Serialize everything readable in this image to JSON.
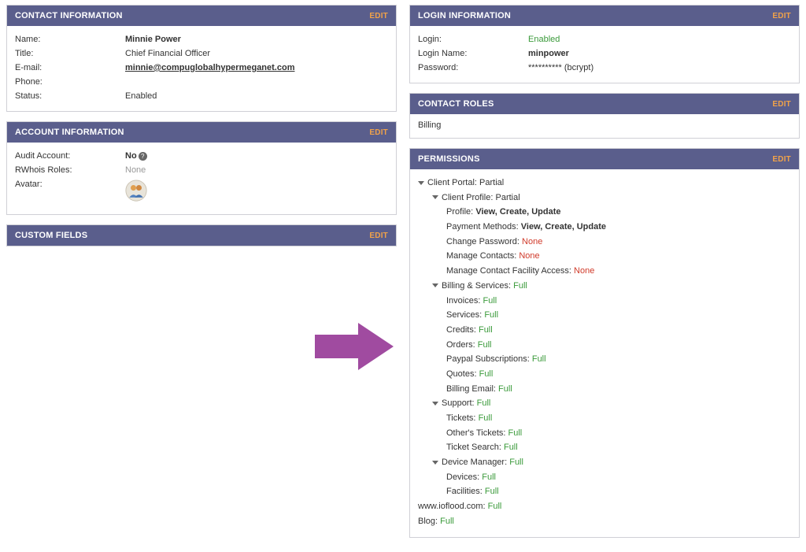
{
  "edit_label": "EDIT",
  "contact": {
    "title": "CONTACT INFORMATION",
    "fields": {
      "name_label": "Name:",
      "name_value": "Minnie Power",
      "title_label": "Title:",
      "title_value": "Chief Financial Officer",
      "email_label": "E-mail:",
      "email_value": "minnie@compuglobalhypermeganet.com",
      "phone_label": "Phone:",
      "phone_value": "",
      "status_label": "Status:",
      "status_value": "Enabled"
    }
  },
  "account": {
    "title": "ACCOUNT INFORMATION",
    "fields": {
      "audit_label": "Audit Account:",
      "audit_value": "No",
      "rwhois_label": "RWhois Roles:",
      "rwhois_value": "None",
      "avatar_label": "Avatar:"
    }
  },
  "custom": {
    "title": "CUSTOM FIELDS"
  },
  "login": {
    "title": "LOGIN INFORMATION",
    "fields": {
      "login_label": "Login:",
      "login_value": "Enabled",
      "loginname_label": "Login Name:",
      "loginname_value": "minpower",
      "password_label": "Password:",
      "password_value": "********** (bcrypt)"
    }
  },
  "roles": {
    "title": "CONTACT ROLES",
    "value": "Billing"
  },
  "permissions": {
    "title": "PERMISSIONS",
    "tree": {
      "client_portal": {
        "label": "Client Portal:",
        "value": "Partial"
      },
      "client_profile": {
        "label": "Client Profile:",
        "value": "Partial"
      },
      "profile": {
        "label": "Profile:",
        "value": "View, Create, Update"
      },
      "payment_methods": {
        "label": "Payment Methods:",
        "value": "View, Create, Update"
      },
      "change_password": {
        "label": "Change Password:",
        "value": "None"
      },
      "manage_contacts": {
        "label": "Manage Contacts:",
        "value": "None"
      },
      "manage_facility": {
        "label": "Manage Contact Facility Access:",
        "value": "None"
      },
      "billing_services": {
        "label": "Billing & Services:",
        "value": "Full"
      },
      "invoices": {
        "label": "Invoices:",
        "value": "Full"
      },
      "services": {
        "label": "Services:",
        "value": "Full"
      },
      "credits": {
        "label": "Credits:",
        "value": "Full"
      },
      "orders": {
        "label": "Orders:",
        "value": "Full"
      },
      "paypal": {
        "label": "Paypal Subscriptions:",
        "value": "Full"
      },
      "quotes": {
        "label": "Quotes:",
        "value": "Full"
      },
      "billing_email": {
        "label": "Billing Email:",
        "value": "Full"
      },
      "support": {
        "label": "Support:",
        "value": "Full"
      },
      "tickets": {
        "label": "Tickets:",
        "value": "Full"
      },
      "others_tickets": {
        "label": "Other's Tickets:",
        "value": "Full"
      },
      "ticket_search": {
        "label": "Ticket Search:",
        "value": "Full"
      },
      "device_manager": {
        "label": "Device Manager:",
        "value": "Full"
      },
      "devices": {
        "label": "Devices:",
        "value": "Full"
      },
      "facilities": {
        "label": "Facilities:",
        "value": "Full"
      },
      "ioflood": {
        "label": "www.ioflood.com:",
        "value": "Full"
      },
      "blog": {
        "label": "Blog:",
        "value": "Full"
      }
    }
  }
}
